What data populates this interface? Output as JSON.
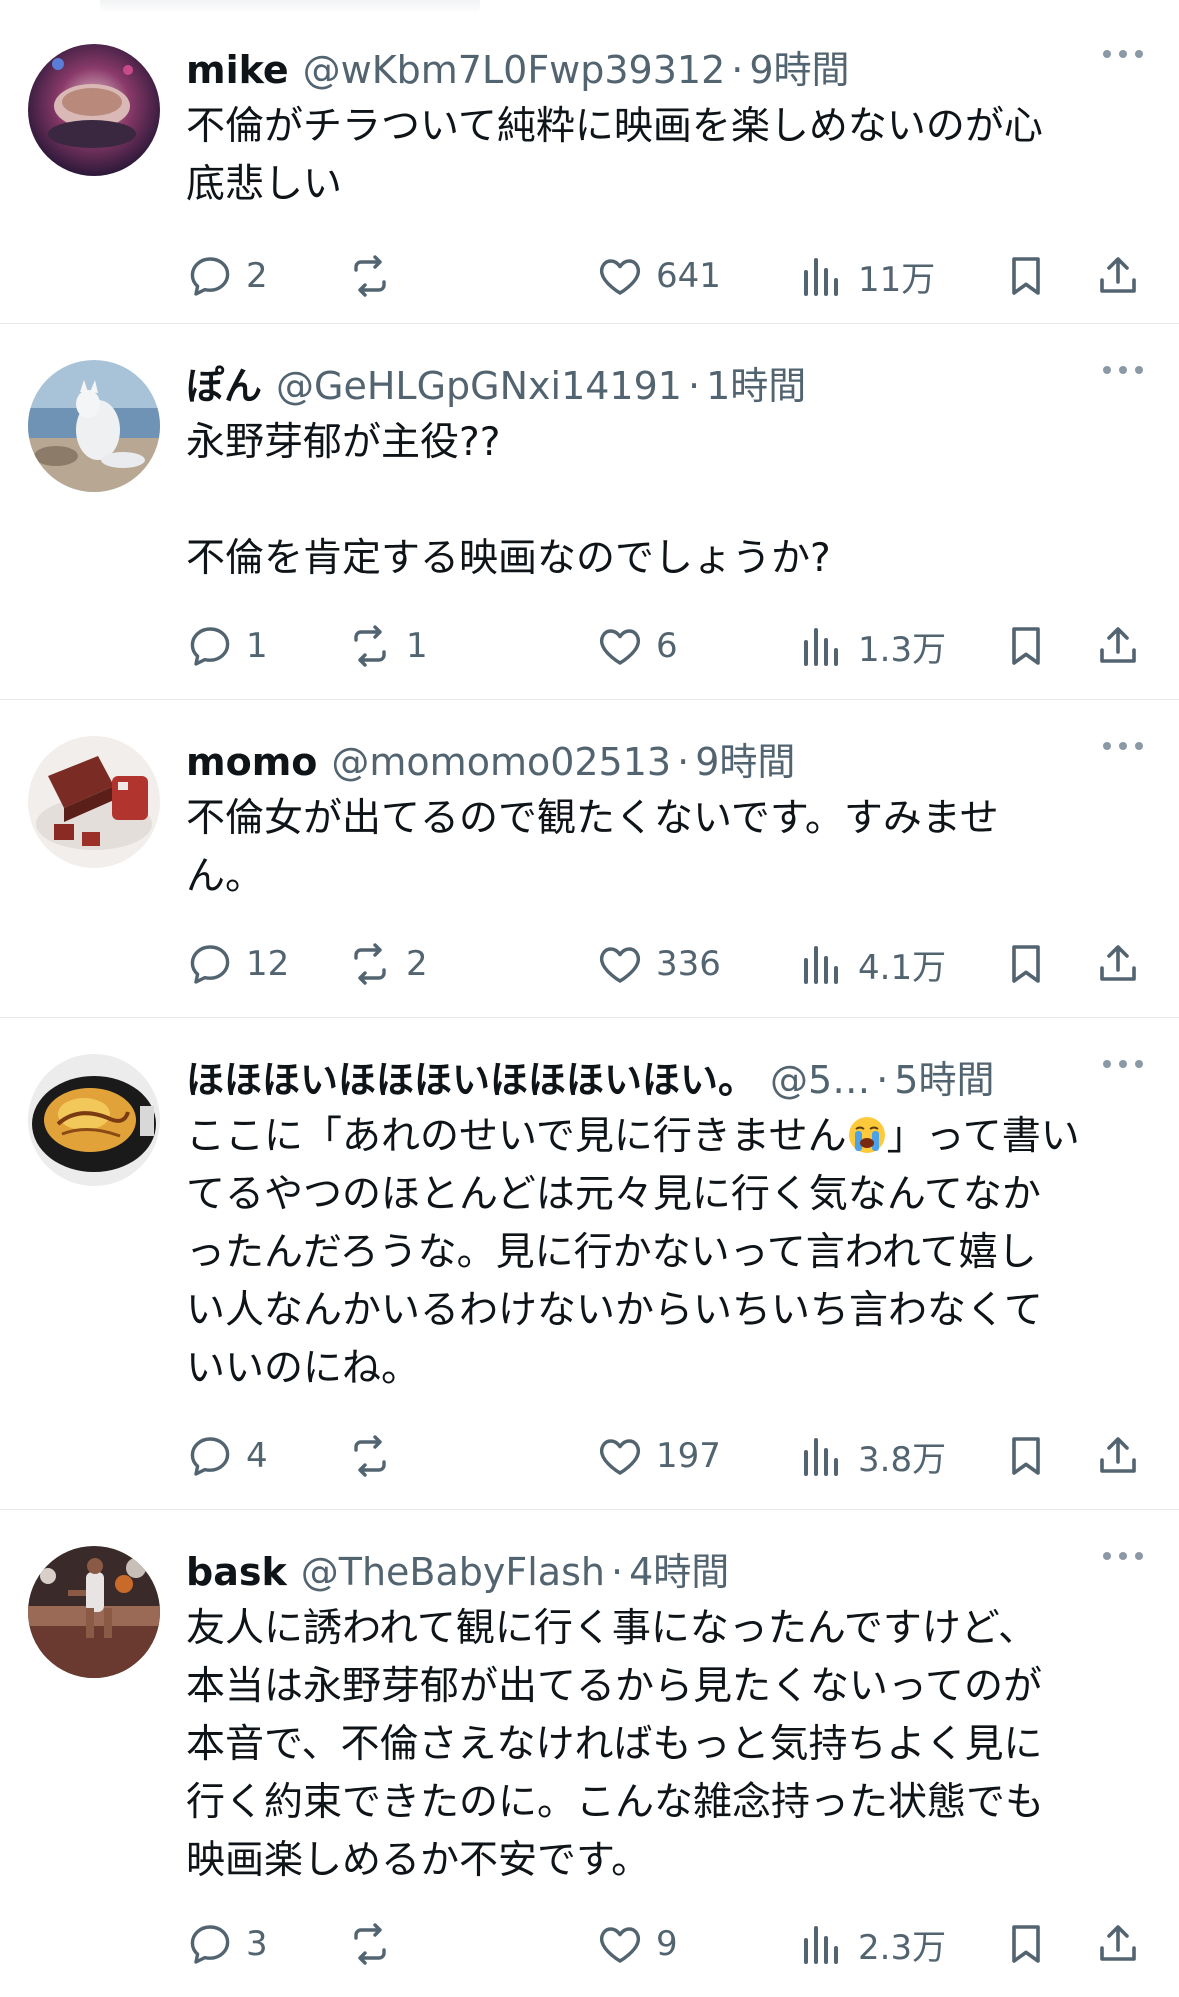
{
  "posts": [
    {
      "name": "mike",
      "handle": "@wKbm7L0Fwp39312",
      "dot": "·",
      "time": "9時間",
      "text": "不倫がチラついて純粋に映画を楽しめないのが心\n底悲しい",
      "replies": "2",
      "reposts": "",
      "likes": "641",
      "views": "11万"
    },
    {
      "name": "ぽん",
      "handle": "@GeHLGpGNxi14191",
      "dot": "·",
      "time": "1時間",
      "text": "永野芽郁が主役??\n\n不倫を肯定する映画なのでしょうか?",
      "replies": "1",
      "reposts": "1",
      "likes": "6",
      "views": "1.3万"
    },
    {
      "name": "momo",
      "handle": "@momomo02513",
      "dot": "·",
      "time": "9時間",
      "text": "不倫女が出てるので観たくないです。すみませ\nん。",
      "replies": "12",
      "reposts": "2",
      "likes": "336",
      "views": "4.1万"
    },
    {
      "name": "ほほほいほほほいほほほいほい。",
      "handle": "@5…",
      "dot": "·",
      "time": "5時間",
      "text_before_emoji": "ここに「あれのせいで見に行きません",
      "emoji": "loudly-crying-face",
      "text_after_emoji": "」って書い\nてるやつのほとんどは元々見に行く気なんてなか\nったんだろうな。見に行かないって言われて嬉し\nい人なんかいるわけないからいちいち言わなくて\nいいのにね。",
      "replies": "4",
      "reposts": "",
      "likes": "197",
      "views": "3.8万"
    },
    {
      "name": "bask",
      "handle": "@TheBabyFlash",
      "dot": "·",
      "time": "4時間",
      "text": "友人に誘われて観に行く事になったんですけど、\n本当は永野芽郁が出てるから見たくないってのが\n本音で、不倫さえなければもっと気持ちよく見に\n行く約束できたのに。こんな雑念持った状態でも\n映画楽しめるか不安です。",
      "replies": "3",
      "reposts": "",
      "likes": "9",
      "views": "2.3万"
    }
  ],
  "colors": {
    "text": "#0f1419",
    "secondary": "#536471",
    "divider": "#e6e8ea"
  },
  "icons": [
    "reply-icon",
    "repost-icon",
    "like-icon",
    "views-icon",
    "bookmark-icon",
    "share-icon",
    "more-icon"
  ]
}
